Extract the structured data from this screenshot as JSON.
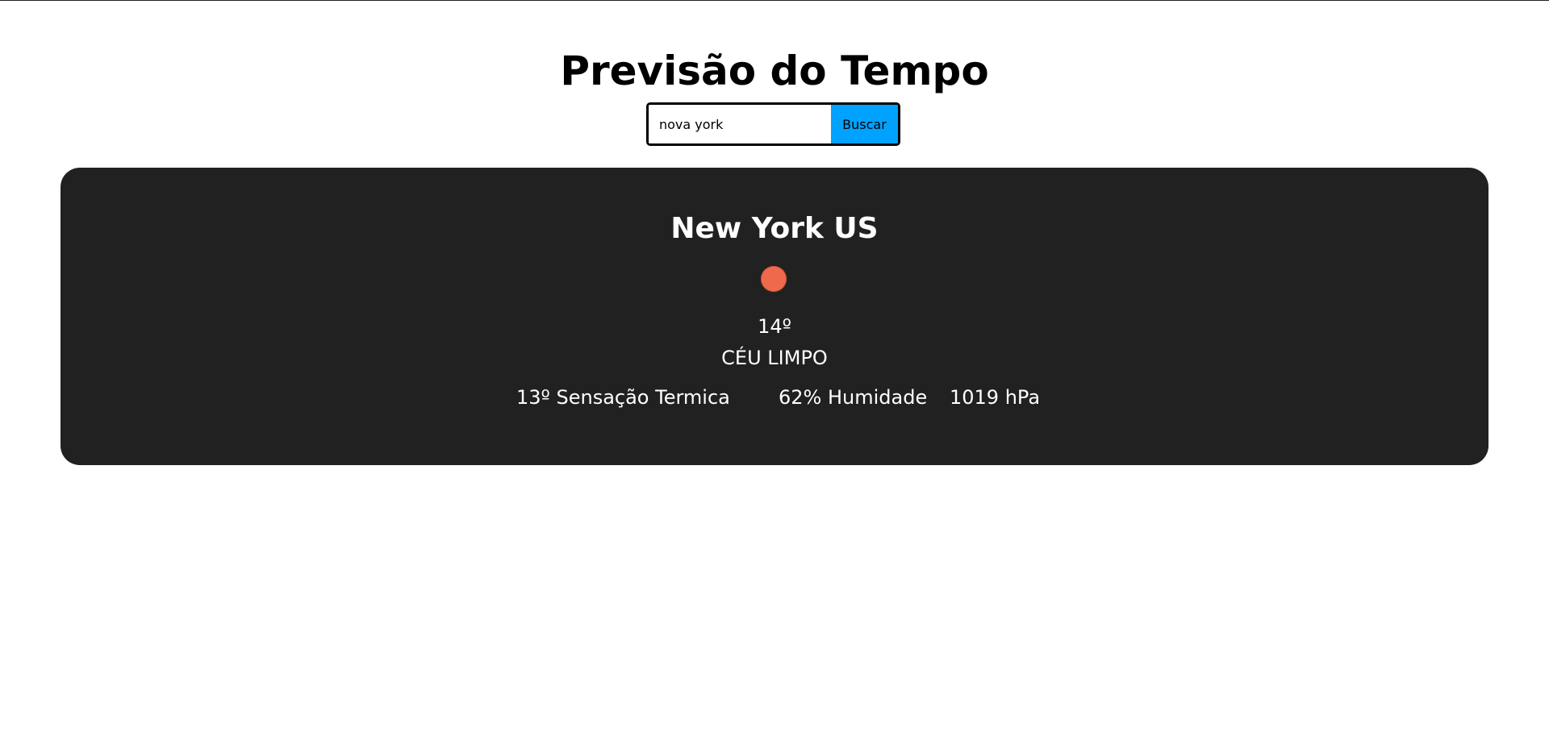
{
  "header": {
    "title": "Previsão do Tempo"
  },
  "search": {
    "value": "nova york",
    "button_label": "Buscar"
  },
  "weather": {
    "city": "New York US",
    "icon": "sun-icon",
    "temperature": "14º",
    "description": "CÉU LIMPO",
    "feels_like": "13º Sensação Termica",
    "humidity": "62% Humidade",
    "pressure": "1019 hPa"
  },
  "colors": {
    "card_background": "#212121",
    "button_background": "#00a2ff",
    "icon_color": "#ef6a4c"
  }
}
